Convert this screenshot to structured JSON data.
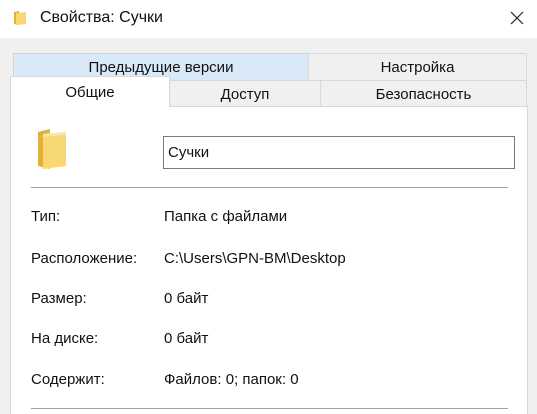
{
  "window": {
    "title": "Свойства: Сучки",
    "close_glyph": "✕"
  },
  "tabs": {
    "row_back": [
      {
        "label": "Предыдущие версии"
      },
      {
        "label": "Настройка"
      }
    ],
    "row_front": [
      {
        "label": "Общие",
        "active": true
      },
      {
        "label": "Доступ"
      },
      {
        "label": "Безопасность"
      }
    ]
  },
  "general": {
    "name_value": "Сучки",
    "properties": [
      {
        "label": "Тип:",
        "value": "Папка с файлами"
      },
      {
        "label": "Расположение:",
        "value": "C:\\Users\\GPN-BM\\Desktop"
      },
      {
        "label": "Размер:",
        "value": "0 байт"
      },
      {
        "label": "На диске:",
        "value": "0 байт"
      },
      {
        "label": "Содержит:",
        "value": "Файлов: 0; папок: 0"
      }
    ]
  },
  "colors": {
    "folder_yellow": "#f8d775",
    "folder_dark": "#e0b13b",
    "tab_hover": "#d9e9f8",
    "frame_grey": "#f0f0f0"
  },
  "icons": {
    "title_icon": "folder-icon",
    "close_icon": "close-icon",
    "large_icon": "folder-icon"
  }
}
